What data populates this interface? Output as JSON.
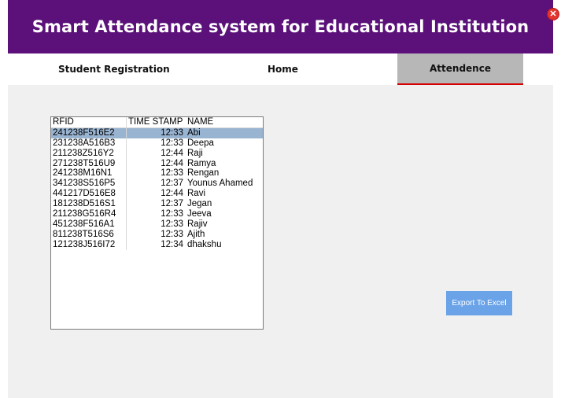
{
  "header": {
    "title": "Smart Attendance system for Educational Institution",
    "close_glyph": "✕"
  },
  "nav": {
    "tabs": [
      {
        "label": "Student Registration"
      },
      {
        "label": "Home"
      },
      {
        "label": "Attendence",
        "active": true
      }
    ]
  },
  "grid": {
    "columns": [
      "RFID",
      "TIME STAMP",
      "NAME"
    ],
    "selected_index": 0,
    "rows": [
      {
        "rfid": "241238F516E2",
        "time": "12:33",
        "name": "Abi"
      },
      {
        "rfid": "231238A516B3",
        "time": "12:33",
        "name": "Deepa"
      },
      {
        "rfid": "211238Z516Y2",
        "time": "12:44",
        "name": "Raji"
      },
      {
        "rfid": "271238T516U9",
        "time": "12:44",
        "name": "Ramya"
      },
      {
        "rfid": "241238M16N1",
        "time": "12:33",
        "name": "Rengan"
      },
      {
        "rfid": "341238S516P5",
        "time": "12:37",
        "name": "Younus Ahamed"
      },
      {
        "rfid": "441217D516E8",
        "time": "12:44",
        "name": "Ravi"
      },
      {
        "rfid": "181238D516S1",
        "time": "12:37",
        "name": "Jegan"
      },
      {
        "rfid": "211238G516R4",
        "time": "12:33",
        "name": "Jeeva"
      },
      {
        "rfid": "451238F516A1",
        "time": "12:33",
        "name": "Rajiv"
      },
      {
        "rfid": "811238T516S6",
        "time": "12:33",
        "name": "Ajith"
      },
      {
        "rfid": "121238J516I72",
        "time": "12:34",
        "name": "dhakshu"
      }
    ]
  },
  "export": {
    "label": "Export To Excel"
  },
  "colors": {
    "header_bg": "#5b1179",
    "active_tab_bg": "#b7b7b7",
    "active_tab_underline": "#d40000",
    "selection": "#99b4d1",
    "export_bg": "#6aa3e8"
  }
}
